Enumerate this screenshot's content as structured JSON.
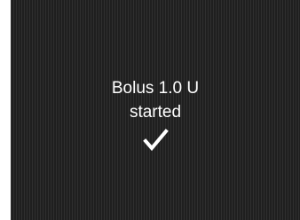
{
  "notification": {
    "line1": "Bolus 1.0 U",
    "line2": "started",
    "icon": "checkmark-icon",
    "text_color": "#ffffff",
    "background_color": "#1f1f1f"
  }
}
